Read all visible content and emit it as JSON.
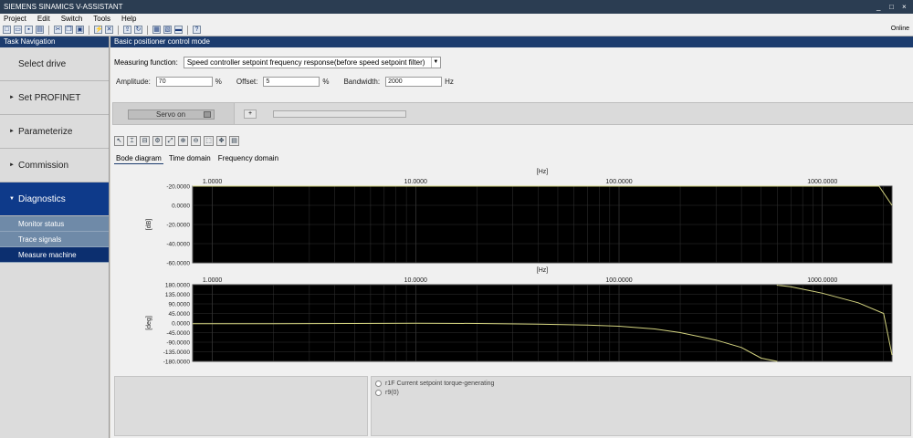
{
  "window": {
    "title": "SIEMENS SINAMICS V-ASSISTANT"
  },
  "menu": [
    "Project",
    "Edit",
    "Switch",
    "Tools",
    "Help"
  ],
  "toolbar": {
    "status": "Online"
  },
  "nav": {
    "header": "Task Navigation",
    "items": [
      {
        "label": "Select drive",
        "arrow": ""
      },
      {
        "label": "Set PROFINET",
        "arrow": "►"
      },
      {
        "label": "Parameterize",
        "arrow": "►"
      },
      {
        "label": "Commission",
        "arrow": "►"
      },
      {
        "label": "Diagnostics",
        "arrow": "▼"
      }
    ],
    "subitems": [
      {
        "label": "Monitor status"
      },
      {
        "label": "Trace signals"
      },
      {
        "label": "Measure machine"
      }
    ]
  },
  "main": {
    "header": "Basic positioner control mode",
    "measuring_function_label": "Measuring function:",
    "measuring_function_value": "Speed controller setpoint frequency response(before speed setpoint filter)",
    "amplitude_label": "Amplitude:",
    "amplitude_value": "70",
    "amplitude_unit": "%",
    "offset_label": "Offset:",
    "offset_value": "5",
    "offset_unit": "%",
    "bandwidth_label": "Bandwidth:",
    "bandwidth_value": "2000",
    "bandwidth_unit": "Hz",
    "servo_label": "Servo on",
    "plus_minus": "+",
    "tabs": [
      "Bode diagram",
      "Time domain",
      "Frequency domain"
    ]
  },
  "legend": [
    "r1F Current setpoint torque-generating",
    "r9(0)"
  ],
  "chart_data": [
    {
      "type": "line",
      "title": "",
      "xlabel": "[Hz]",
      "ylabel": "[dB]",
      "xscale": "log",
      "xlim": [
        0.8,
        2200
      ],
      "ylim": [
        -60,
        -20
      ],
      "x_ticks": [
        "1.0000",
        "10.0000",
        "100.0000",
        "1000.0000"
      ],
      "y_ticks": [
        "-20.0000",
        "0.0000",
        "-20.0000",
        "-40.0000",
        "-60.0000"
      ],
      "series": [
        {
          "x": [
            0.8,
            2,
            5,
            10,
            20,
            40,
            70,
            100,
            200,
            300,
            500,
            700,
            1000,
            1500,
            1900,
            2200
          ],
          "values": [
            0,
            0,
            0,
            0,
            -1,
            -1,
            0,
            0,
            1,
            3,
            0,
            -3,
            -8,
            -14,
            -20,
            -30
          ]
        }
      ],
      "line_color": "#d4d480",
      "background": "#000000"
    },
    {
      "type": "line",
      "title": "",
      "xlabel": "[Hz]",
      "ylabel": "[deg]",
      "xscale": "log",
      "xlim": [
        0.8,
        2200
      ],
      "ylim": [
        -180,
        180
      ],
      "x_ticks": [
        "1.0000",
        "10.0000",
        "100.0000",
        "1000.0000"
      ],
      "y_ticks": [
        "180.0000",
        "135.0000",
        "90.0000",
        "45.0000",
        "0.0000",
        "-45.0000",
        "-90.0000",
        "-135.0000",
        "-180.0000"
      ],
      "series": [
        {
          "x": [
            0.8,
            2,
            5,
            10,
            20,
            40,
            70,
            100,
            150,
            200,
            300,
            400,
            500,
            600,
            700,
            1000,
            1500,
            2000,
            2200
          ],
          "values": [
            -3,
            -3,
            -2,
            -1,
            -2,
            -5,
            -10,
            -15,
            -28,
            -45,
            -80,
            -115,
            -165,
            178,
            170,
            140,
            95,
            45,
            -150
          ]
        }
      ],
      "line_color": "#d4d480",
      "background": "#000000"
    }
  ]
}
